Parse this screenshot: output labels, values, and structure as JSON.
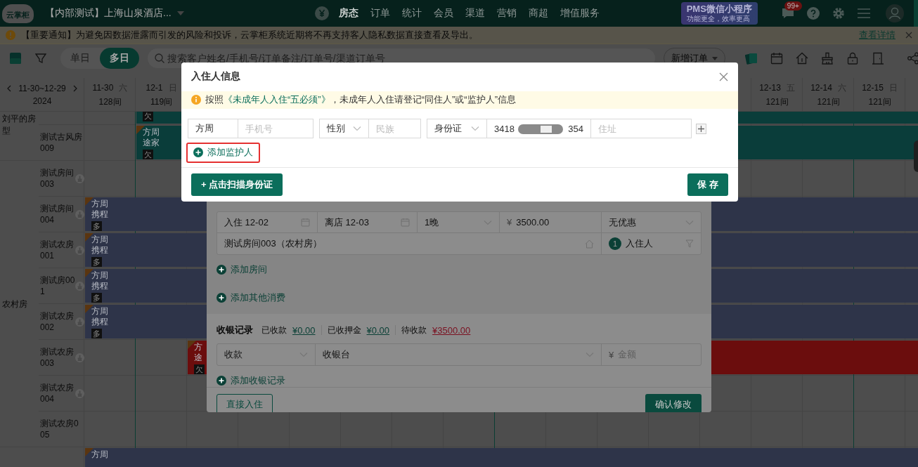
{
  "top_bar": {
    "logo": "云掌柜",
    "hotel": "【内部测试】上海山泉酒店...",
    "nav": [
      {
        "label": "房态",
        "selected": true
      },
      {
        "label": "订单",
        "selected": false
      },
      {
        "label": "统计",
        "selected": false
      },
      {
        "label": "会员",
        "selected": false
      },
      {
        "label": "渠道",
        "selected": false
      },
      {
        "label": "营销",
        "selected": false
      },
      {
        "label": "商超",
        "selected": false
      },
      {
        "label": "增值服务",
        "selected": false
      }
    ],
    "promo": {
      "title": "PMS微信小程序",
      "subtitle": "功能更全，效率更高"
    },
    "message_badge": "99+"
  },
  "notice": {
    "text": "【重要通知】为避免因数据泄露而引发的风险和投诉，云掌柜系统近期将不再支持客人隐私数据直接查看及导出。",
    "link": "查看详情"
  },
  "toolbar": {
    "views": [
      {
        "label": "单日",
        "selected": false
      },
      {
        "label": "多日",
        "selected": true
      }
    ],
    "search": {
      "placeholder": "搜索客户姓名/手机号/订单备注/订单号/渠道订单号"
    },
    "new_order": "新增订单"
  },
  "calendar": {
    "range": "11-30~12-29",
    "year": "2024",
    "dates": [
      {
        "date": "11-30",
        "weekday": "六",
        "rooms": "128间"
      },
      {
        "date": "12-1",
        "weekday": "日",
        "rooms": "119间"
      },
      {
        "date": "12-13",
        "weekday": "五",
        "rooms": "121间"
      },
      {
        "date": "12-14",
        "weekday": "六",
        "rooms": "121间"
      },
      {
        "date": "12-15",
        "weekday": "日",
        "rooms": "121间"
      }
    ],
    "room_types": [
      {
        "name": "刘平的房型",
        "rooms": [
          {
            "days": [
              {
                "kind": "free"
              },
              {
                "kind": "booking",
                "tag": "欠",
                "color": "#0a3d3a"
              }
            ]
          },
          {
            "name": "测试古风房009",
            "needs_cleaning": false,
            "days": [
              {
                "kind": "free"
              },
              {
                "kind": "booking",
                "guest": "方周",
                "channel": "途家",
                "tag": "欠",
                "color": "#0a3d3a"
              }
            ]
          }
        ]
      },
      {
        "name": "农村房",
        "rooms": [
          {
            "name": "测试房间003",
            "needs_cleaning": true
          },
          {
            "name": "测试房间004",
            "needs_cleaning": true,
            "days": [
              {
                "kind": "booking",
                "guest": "方周",
                "channel": "携程",
                "tag": "多",
                "color": "#2e3449"
              }
            ]
          },
          {
            "name": "测试农房001",
            "needs_cleaning": true,
            "days": [
              {
                "kind": "booking",
                "guest": "方周",
                "channel": "携程",
                "tag": "多",
                "color": "#2e3449"
              }
            ]
          },
          {
            "name": "测试房001",
            "needs_cleaning": true,
            "days": [
              {
                "kind": "booking",
                "guest": "方周",
                "channel": "携程",
                "tag": "多",
                "color": "#2e3449"
              }
            ]
          },
          {
            "name": "测试农房002",
            "needs_cleaning": true,
            "days": [
              {
                "kind": "booking",
                "guest": "方周",
                "channel": "携程",
                "tag": "多",
                "color": "#2e3449"
              }
            ]
          },
          {
            "name": "测试农房003",
            "needs_cleaning": true,
            "days": [
              {
                "kind": "free"
              },
              {
                "kind": "free"
              },
              {
                "kind": "booking",
                "guest": "方",
                "channel": "途",
                "tag": "欠",
                "color": "#6b0d0d"
              }
            ]
          },
          {
            "name": "测试农房004",
            "needs_cleaning": true
          },
          {
            "name": "测试农房005",
            "needs_cleaning": false
          }
        ]
      },
      {
        "rooms": [
          {
            "needs_cleaning": false,
            "days": [
              {
                "kind": "booking",
                "guest": "方周",
                "color": "#2e3449"
              }
            ]
          }
        ]
      }
    ]
  },
  "order_panel": {
    "check_in": "入住 12-02",
    "check_out": "离店 12-03",
    "nights": "1晚",
    "currency": "¥",
    "price": "3500.00",
    "discount": "无优惠",
    "room": "测试房间003（农村房）",
    "guest_count": "1",
    "guest_label": "入住人",
    "add_room": "添加房间",
    "add_other": "添加其他消费",
    "cashier": {
      "title": "收银记录",
      "items": [
        {
          "label": "已收款",
          "amount": "¥0.00",
          "kind": "paid"
        },
        {
          "label": "已收押金",
          "amount": "¥0.00",
          "kind": "paid"
        },
        {
          "label": "待收款",
          "amount": "¥3500.00",
          "kind": "due"
        }
      ],
      "type": "收款",
      "account": "收银台",
      "currency": "¥",
      "amount_placeholder": "金额",
      "add": "添加收银记录"
    },
    "buttons": [
      {
        "label": "直接入住",
        "kind": "secondary"
      },
      {
        "label": "确认修改",
        "kind": "primary"
      }
    ]
  },
  "guest_dialog": {
    "title": "入住人信息",
    "notice": {
      "before": "按照",
      "link": "《未成年人入住“五必须”》",
      "after": "，未成年人入住请登记“同住人”或“监护人”信息"
    },
    "name": {
      "value": "方周"
    },
    "phone": {
      "placeholder": "手机号"
    },
    "gender": {
      "value": "性别"
    },
    "ethnicity": {
      "placeholder": "民族"
    },
    "id_type": {
      "value": "身份证"
    },
    "id_number": {
      "start": "3418",
      "end": "354"
    },
    "address": {
      "placeholder": "住址"
    },
    "add_guardian": {
      "label": "添加监护人",
      "highlighted": true
    },
    "scan_button": "+ 点击扫描身份证",
    "save_button": "保 存"
  }
}
